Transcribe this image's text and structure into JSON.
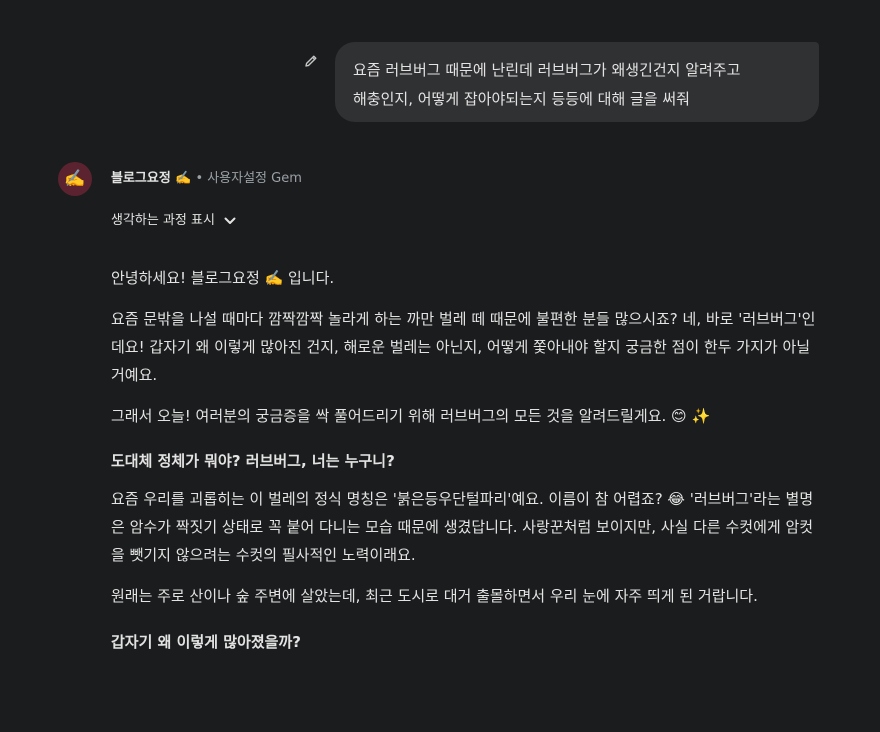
{
  "user_message": {
    "line1": "요즘 러브버그 때문에 난린데 러브버그가 왜생긴건지 알려주고",
    "line2": "해충인지, 어떻게 잡아야되는지 등등에 대해 글을 써줘"
  },
  "gem": {
    "avatar": "✍️",
    "name": "블로그요정 ✍️",
    "separator": "•",
    "type": "사용자설정 Gem"
  },
  "thinking": {
    "label": "생각하는 과정 표시",
    "icon": "chevron-down-icon"
  },
  "response": {
    "p1": "안녕하세요! 블로그요정 ✍️ 입니다.",
    "p2": "요즘 문밖을 나설 때마다 깜짝깜짝 놀라게 하는 까만 벌레 떼 때문에 불편한 분들 많으시죠? 네, 바로 '러브버그'인데요! 갑자기 왜 이렇게 많아진 건지, 해로운 벌레는 아닌지, 어떻게 쫓아내야 할지 궁금한 점이 한두 가지가 아닐 거예요.",
    "p3": "그래서 오늘! 여러분의 궁금증을 싹 풀어드리기 위해 러브버그의 모든 것을 알려드릴게요. 😊 ✨",
    "h1": "도대체 정체가 뭐야? 러브버그, 너는 누구니?",
    "p4": "요즘 우리를 괴롭히는 이 벌레의 정식 명칭은 '붉은등우단털파리'예요. 이름이 참 어렵죠? 😂 '러브버그'라는 별명은 암수가 짝짓기 상태로 꼭 붙어 다니는 모습 때문에 생겼답니다. 사랑꾼처럼 보이지만, 사실 다른 수컷에게 암컷을 뺏기지 않으려는 수컷의 필사적인 노력이래요.",
    "p5": "원래는 주로 산이나 숲 주변에 살았는데, 최근 도시로 대거 출몰하면서 우리 눈에 자주 띄게 된 거랍니다.",
    "h2": "갑자기 왜 이렇게 많아졌을까?"
  }
}
